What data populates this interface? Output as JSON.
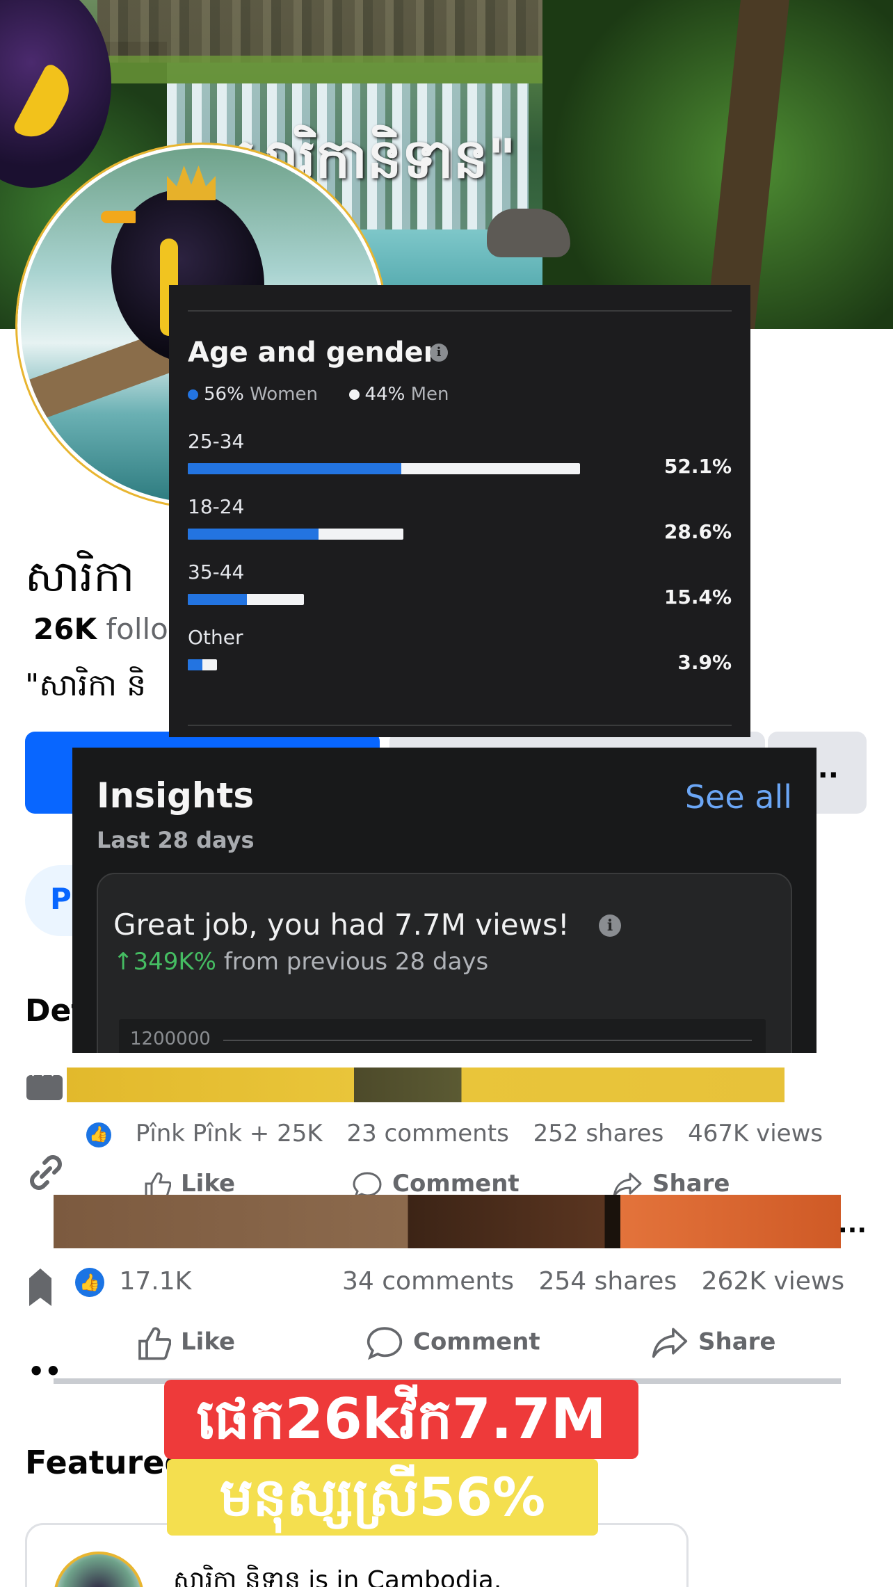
{
  "cover": {
    "title_text": "សារិកានិទាន\""
  },
  "profile": {
    "name": "សារិកា",
    "followers_count": "26K",
    "followers_label": "follow",
    "bio": "\"សារិកា និ",
    "posts_tab_label": "P",
    "details_heading": "Det"
  },
  "age_gender": {
    "title": "Age and gender",
    "women": {
      "pct": "56%",
      "label": "Women"
    },
    "men": {
      "pct": "44%",
      "label": "Men"
    },
    "colors": {
      "women": "#2374e1",
      "men": "#f2f3f5"
    },
    "groups": [
      {
        "label": "25-34",
        "value": "52.1%",
        "total": 52.1,
        "women_share": 0.545
      },
      {
        "label": "18-24",
        "value": "28.6%",
        "total": 28.6,
        "women_share": 0.605
      },
      {
        "label": "35-44",
        "value": "15.4%",
        "total": 15.4,
        "women_share": 0.51
      },
      {
        "label": "Other",
        "value": "3.9%",
        "total": 3.9,
        "women_share": 0.5
      }
    ]
  },
  "insights": {
    "title": "Insights",
    "see_all": "See all",
    "period": "Last 28 days",
    "headline": "Great job, you had 7.7M views!",
    "growth_value": "↑349K%",
    "growth_text": "from previous 28 days",
    "chart_tick": "1200000"
  },
  "post1": {
    "reactions": "Pînk Pînk + 25K",
    "comments": "23 comments",
    "shares": "252 shares",
    "views": "467K views",
    "like_label": "Like",
    "comment_label": "Comment",
    "share_label": "Share"
  },
  "post2": {
    "more": "...",
    "likes": "17.1K",
    "comments": "34 comments",
    "shares": "254 shares",
    "views": "262K views",
    "like_label": "Like",
    "comment_label": "Comment",
    "share_label": "Share"
  },
  "overlays": {
    "red_banner": "ផេក26kវីក7.7M",
    "yellow_banner": "មនុស្សស្រី56%"
  },
  "featured": {
    "heading": "Featured",
    "text_khmer": "សារិកា និទាន",
    "text_rest": "is in Cambodia."
  },
  "more_button": "..."
}
